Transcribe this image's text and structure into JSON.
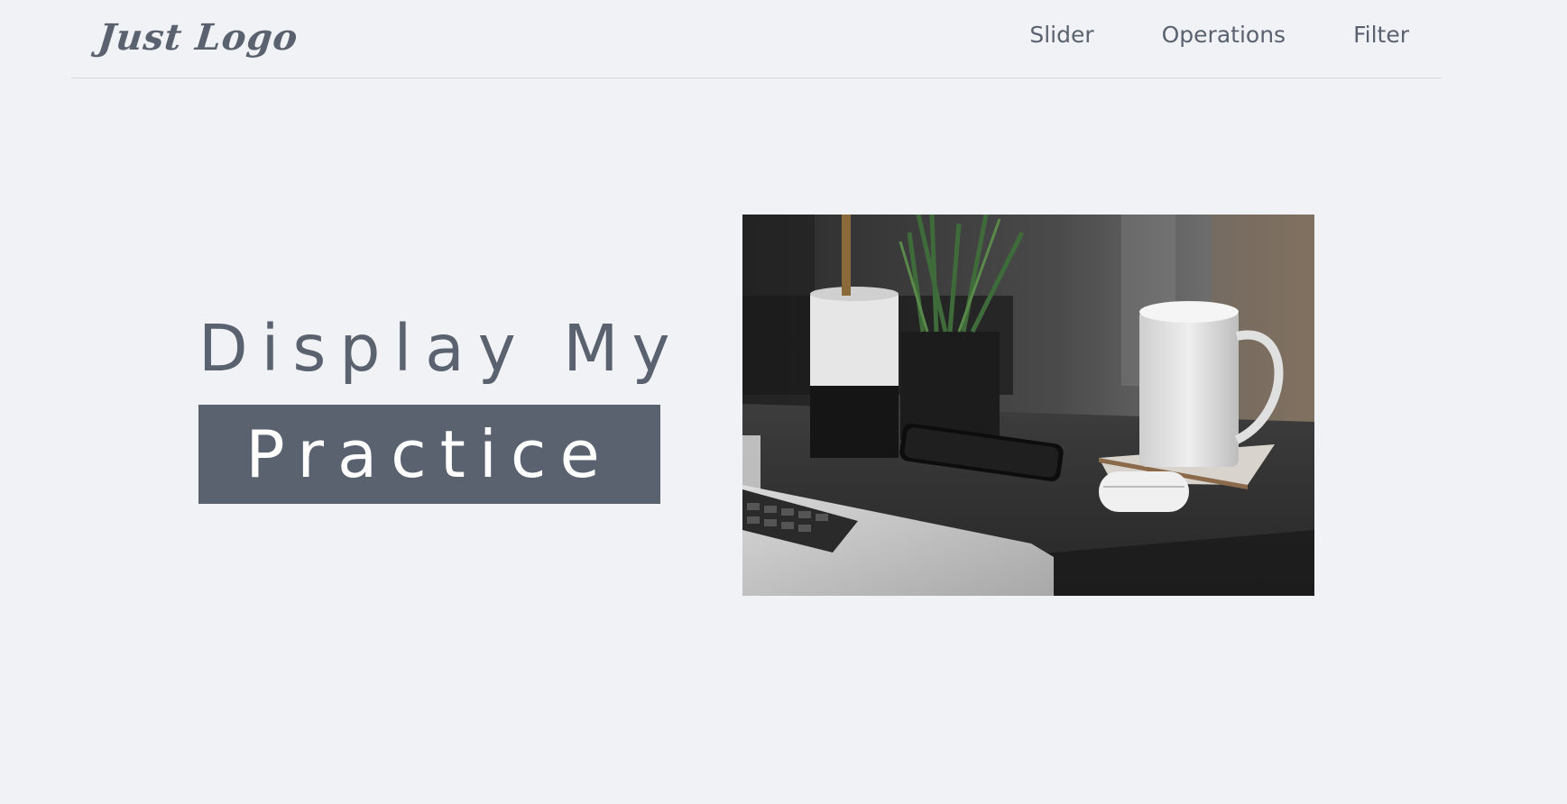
{
  "header": {
    "logo_text": "Just Logo",
    "nav_items": [
      {
        "label": "Slider"
      },
      {
        "label": "Operations"
      },
      {
        "label": "Filter"
      }
    ]
  },
  "hero": {
    "title_line1": "Display My",
    "title_line2": "Practice"
  },
  "colors": {
    "background": "#f0f2f5",
    "text": "#5a6270",
    "badge_bg": "#5a6270",
    "badge_text": "#ffffff"
  }
}
